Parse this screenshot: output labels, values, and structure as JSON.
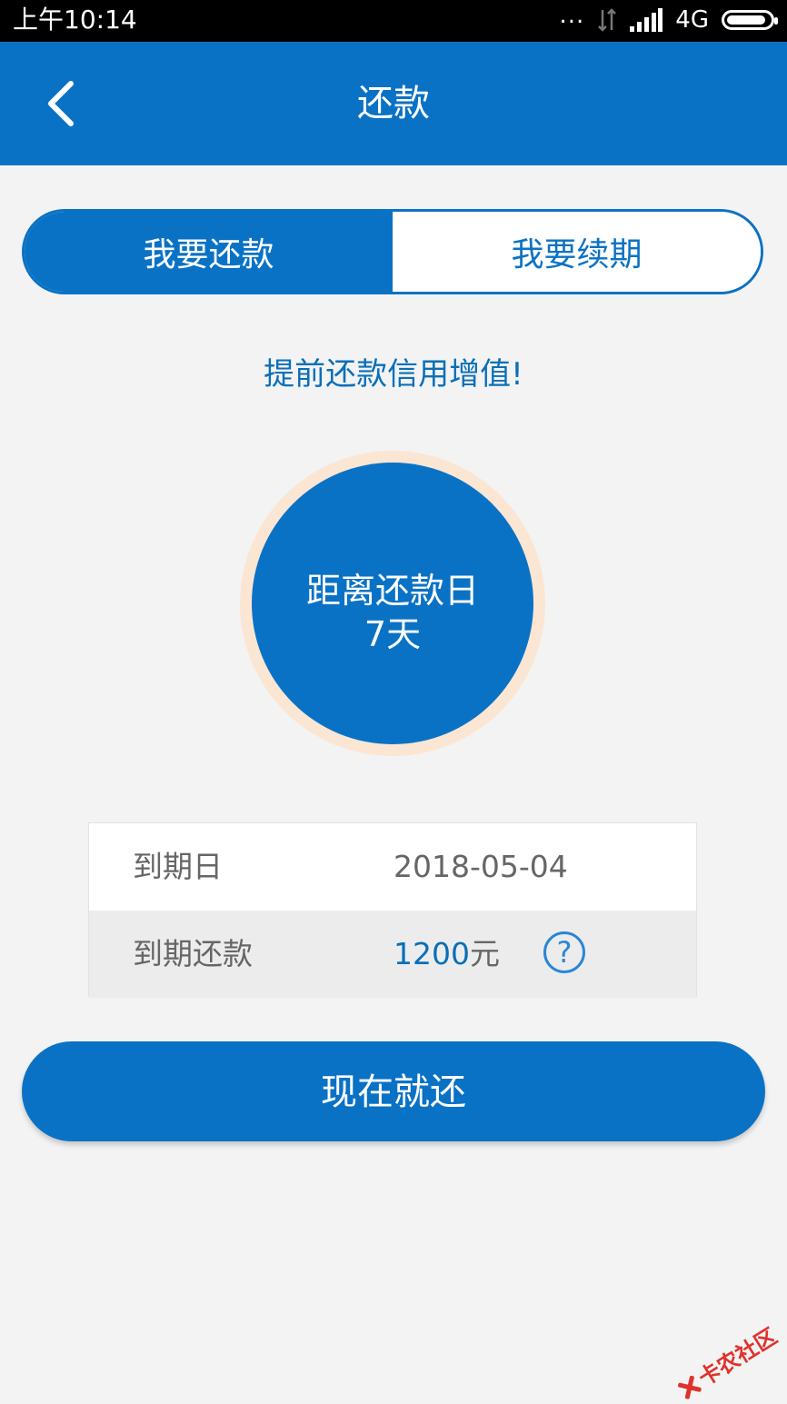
{
  "status_bar": {
    "time": "上午10:14",
    "dots": "...",
    "network": "4G",
    "signal_icon": "cellular-signal-icon",
    "data_icon": "data-transfer-icon",
    "battery_icon": "battery-icon"
  },
  "nav": {
    "back_icon": "chevron-left-icon",
    "title": "还款"
  },
  "segments": [
    {
      "label": "我要还款",
      "active": true
    },
    {
      "label": "我要续期",
      "active": false
    }
  ],
  "slogan": "提前还款信用增值!",
  "countdown": {
    "label": "距离还款日",
    "days": "7天"
  },
  "details": {
    "due_date_label": "到期日",
    "due_date_value": "2018-05-04",
    "amount_label": "到期还款",
    "amount_number": "1200",
    "amount_unit": "元",
    "help_icon": "question-circle-icon",
    "help_symbol": "?"
  },
  "pay_button": "现在就还",
  "watermark": "卡农社区",
  "colors": {
    "primary": "#0a72c5",
    "ring": "#fbe6d4",
    "background": "#f3f3f3",
    "watermark": "#e0322c"
  }
}
